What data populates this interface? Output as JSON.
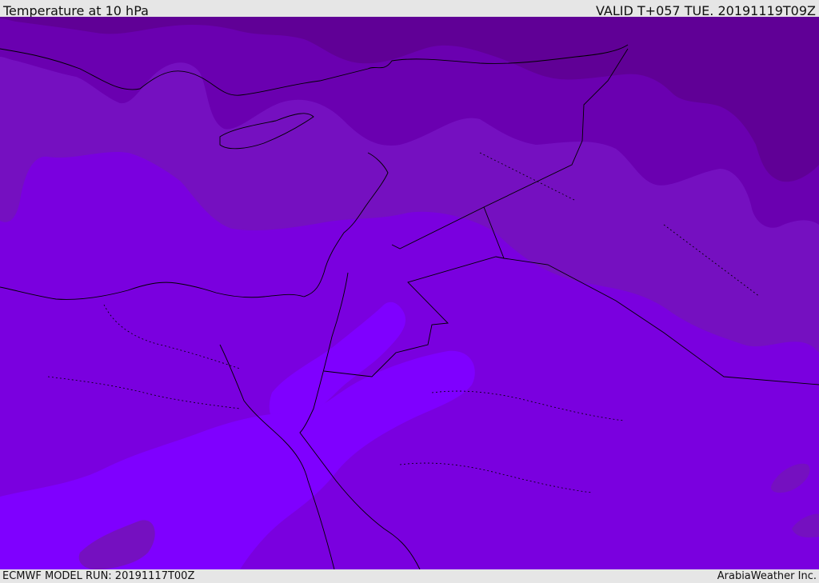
{
  "header": {
    "title": "Temperature at 10 hPa",
    "valid": "VALID T+057 TUE. 20191119T09Z"
  },
  "footer": {
    "model_run": "ECMWF MODEL RUN: 20191117T00Z",
    "credit": "ArabiaWeather Inc."
  },
  "colors": {
    "darkest": "#600096",
    "dark": "#6a00b0",
    "mid": "#7510c0",
    "base": "#7a00df",
    "light": "#7f00ff",
    "border": "#000000"
  }
}
